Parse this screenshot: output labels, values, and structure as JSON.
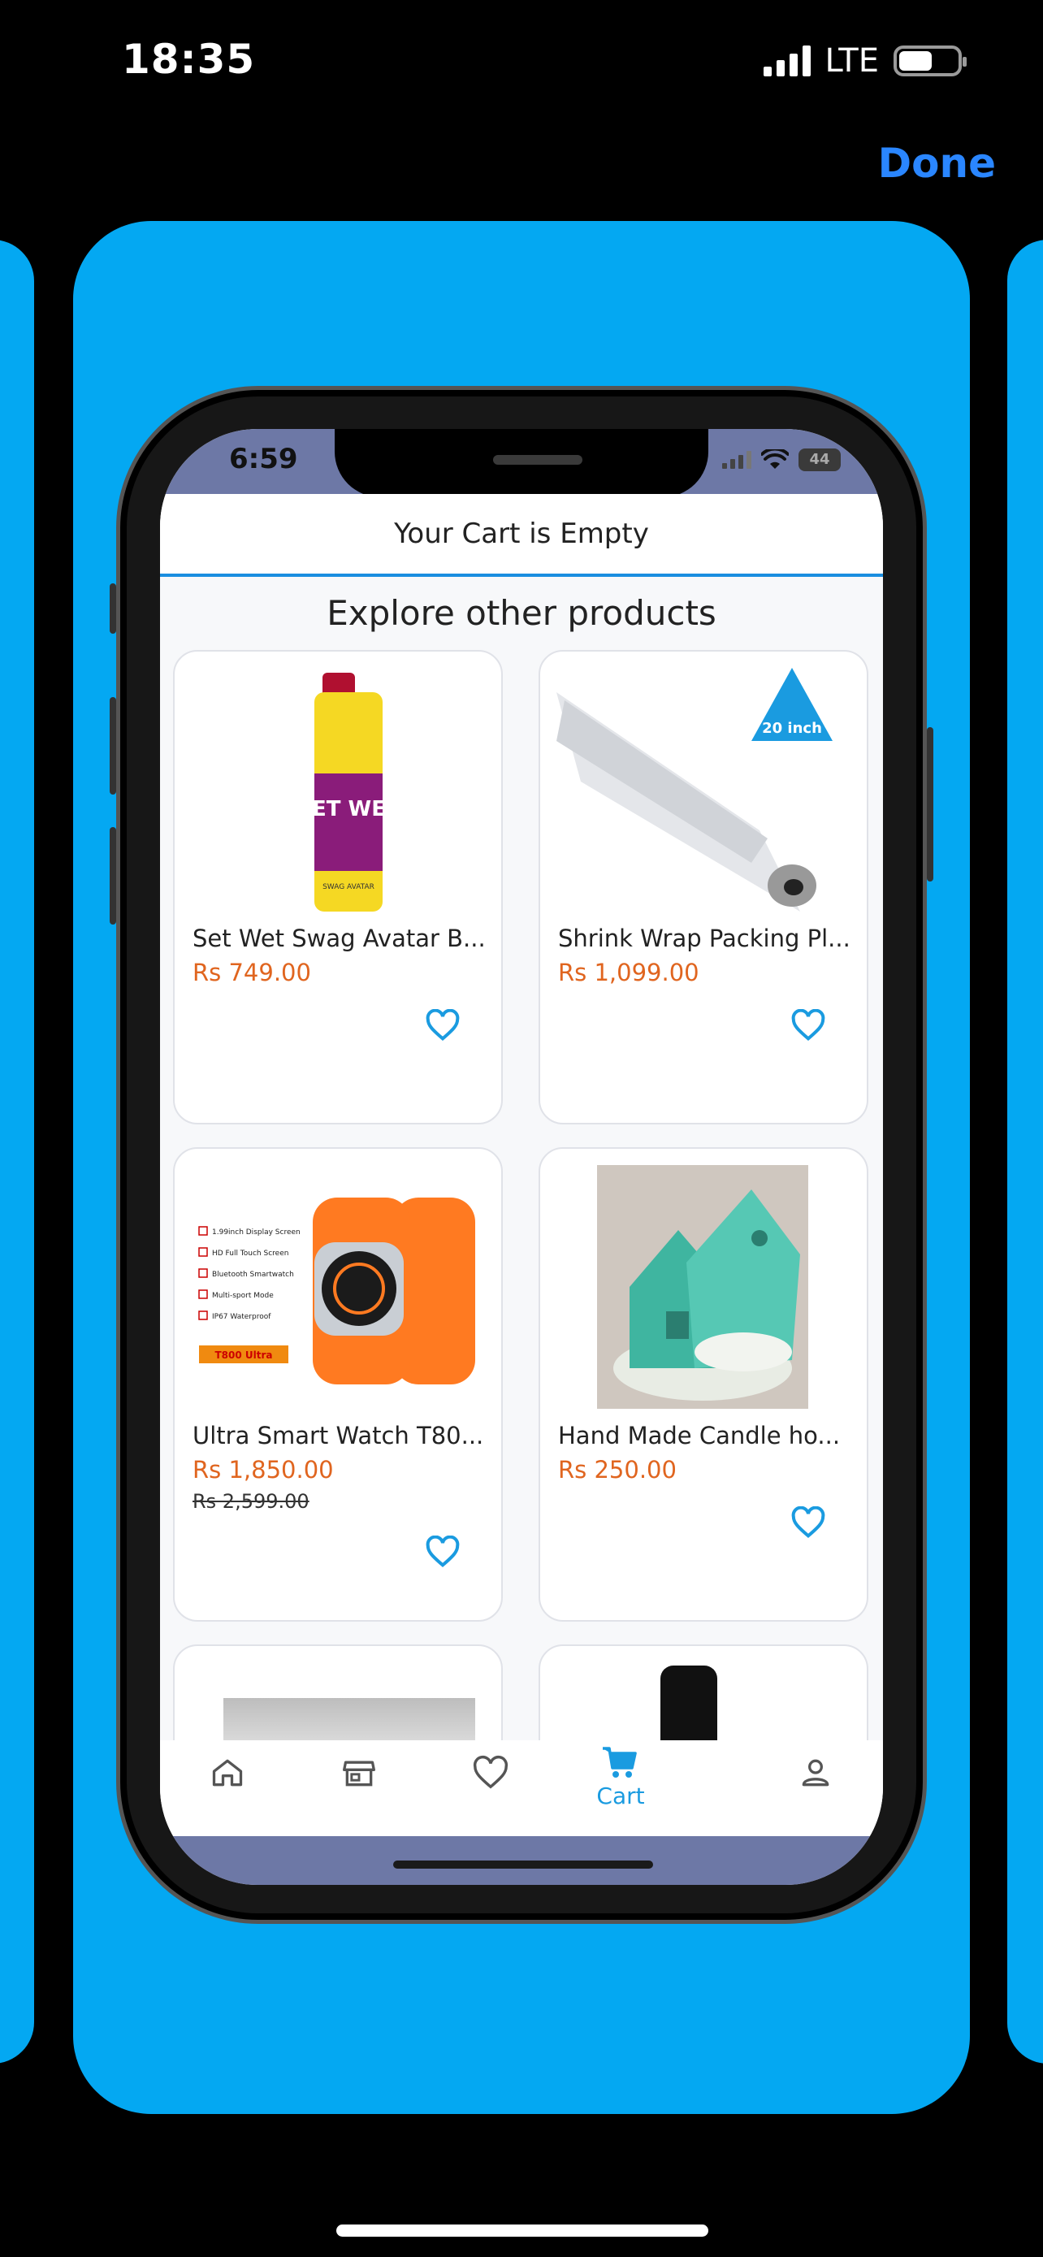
{
  "status_bar": {
    "time": "18:35",
    "network": "LTE"
  },
  "nav": {
    "done_label": "Done"
  },
  "phone": {
    "status_time": "6:59",
    "battery": "44",
    "cart_title": "Your Cart is Empty",
    "explore_title": "Explore other products",
    "products": [
      {
        "name": "Set Wet Swag Avatar B...",
        "price": "Rs 749.00",
        "old_price": ""
      },
      {
        "name": "Shrink Wrap Packing Pl...",
        "price": "Rs 1,099.00",
        "old_price": "",
        "badge": "20 inch"
      },
      {
        "name": "Ultra Smart Watch T80...",
        "price": "Rs 1,850.00",
        "old_price": "Rs 2,599.00",
        "features": [
          "1.99inch Display Screen",
          "HD Full Touch Screen",
          "Bluetooth Smartwatch",
          "Multi-sport Mode",
          "IP67 Waterproof"
        ],
        "badge": "T800 Ultra"
      },
      {
        "name": "Hand Made Candle ho...",
        "price": "Rs 250.00",
        "old_price": ""
      }
    ],
    "product_labels": {
      "set_wet_brand": "SET WET",
      "set_wet_sub": "SWAG AVATAR"
    },
    "tabs": [
      {
        "icon": "home-icon",
        "label": ""
      },
      {
        "icon": "store-icon",
        "label": ""
      },
      {
        "icon": "heart-icon",
        "label": ""
      },
      {
        "icon": "cart-icon",
        "label": "Cart"
      },
      {
        "icon": "user-icon",
        "label": ""
      }
    ]
  },
  "colors": {
    "accent": "#04a8f2",
    "price": "#e0651f",
    "link": "#2a86ff"
  }
}
